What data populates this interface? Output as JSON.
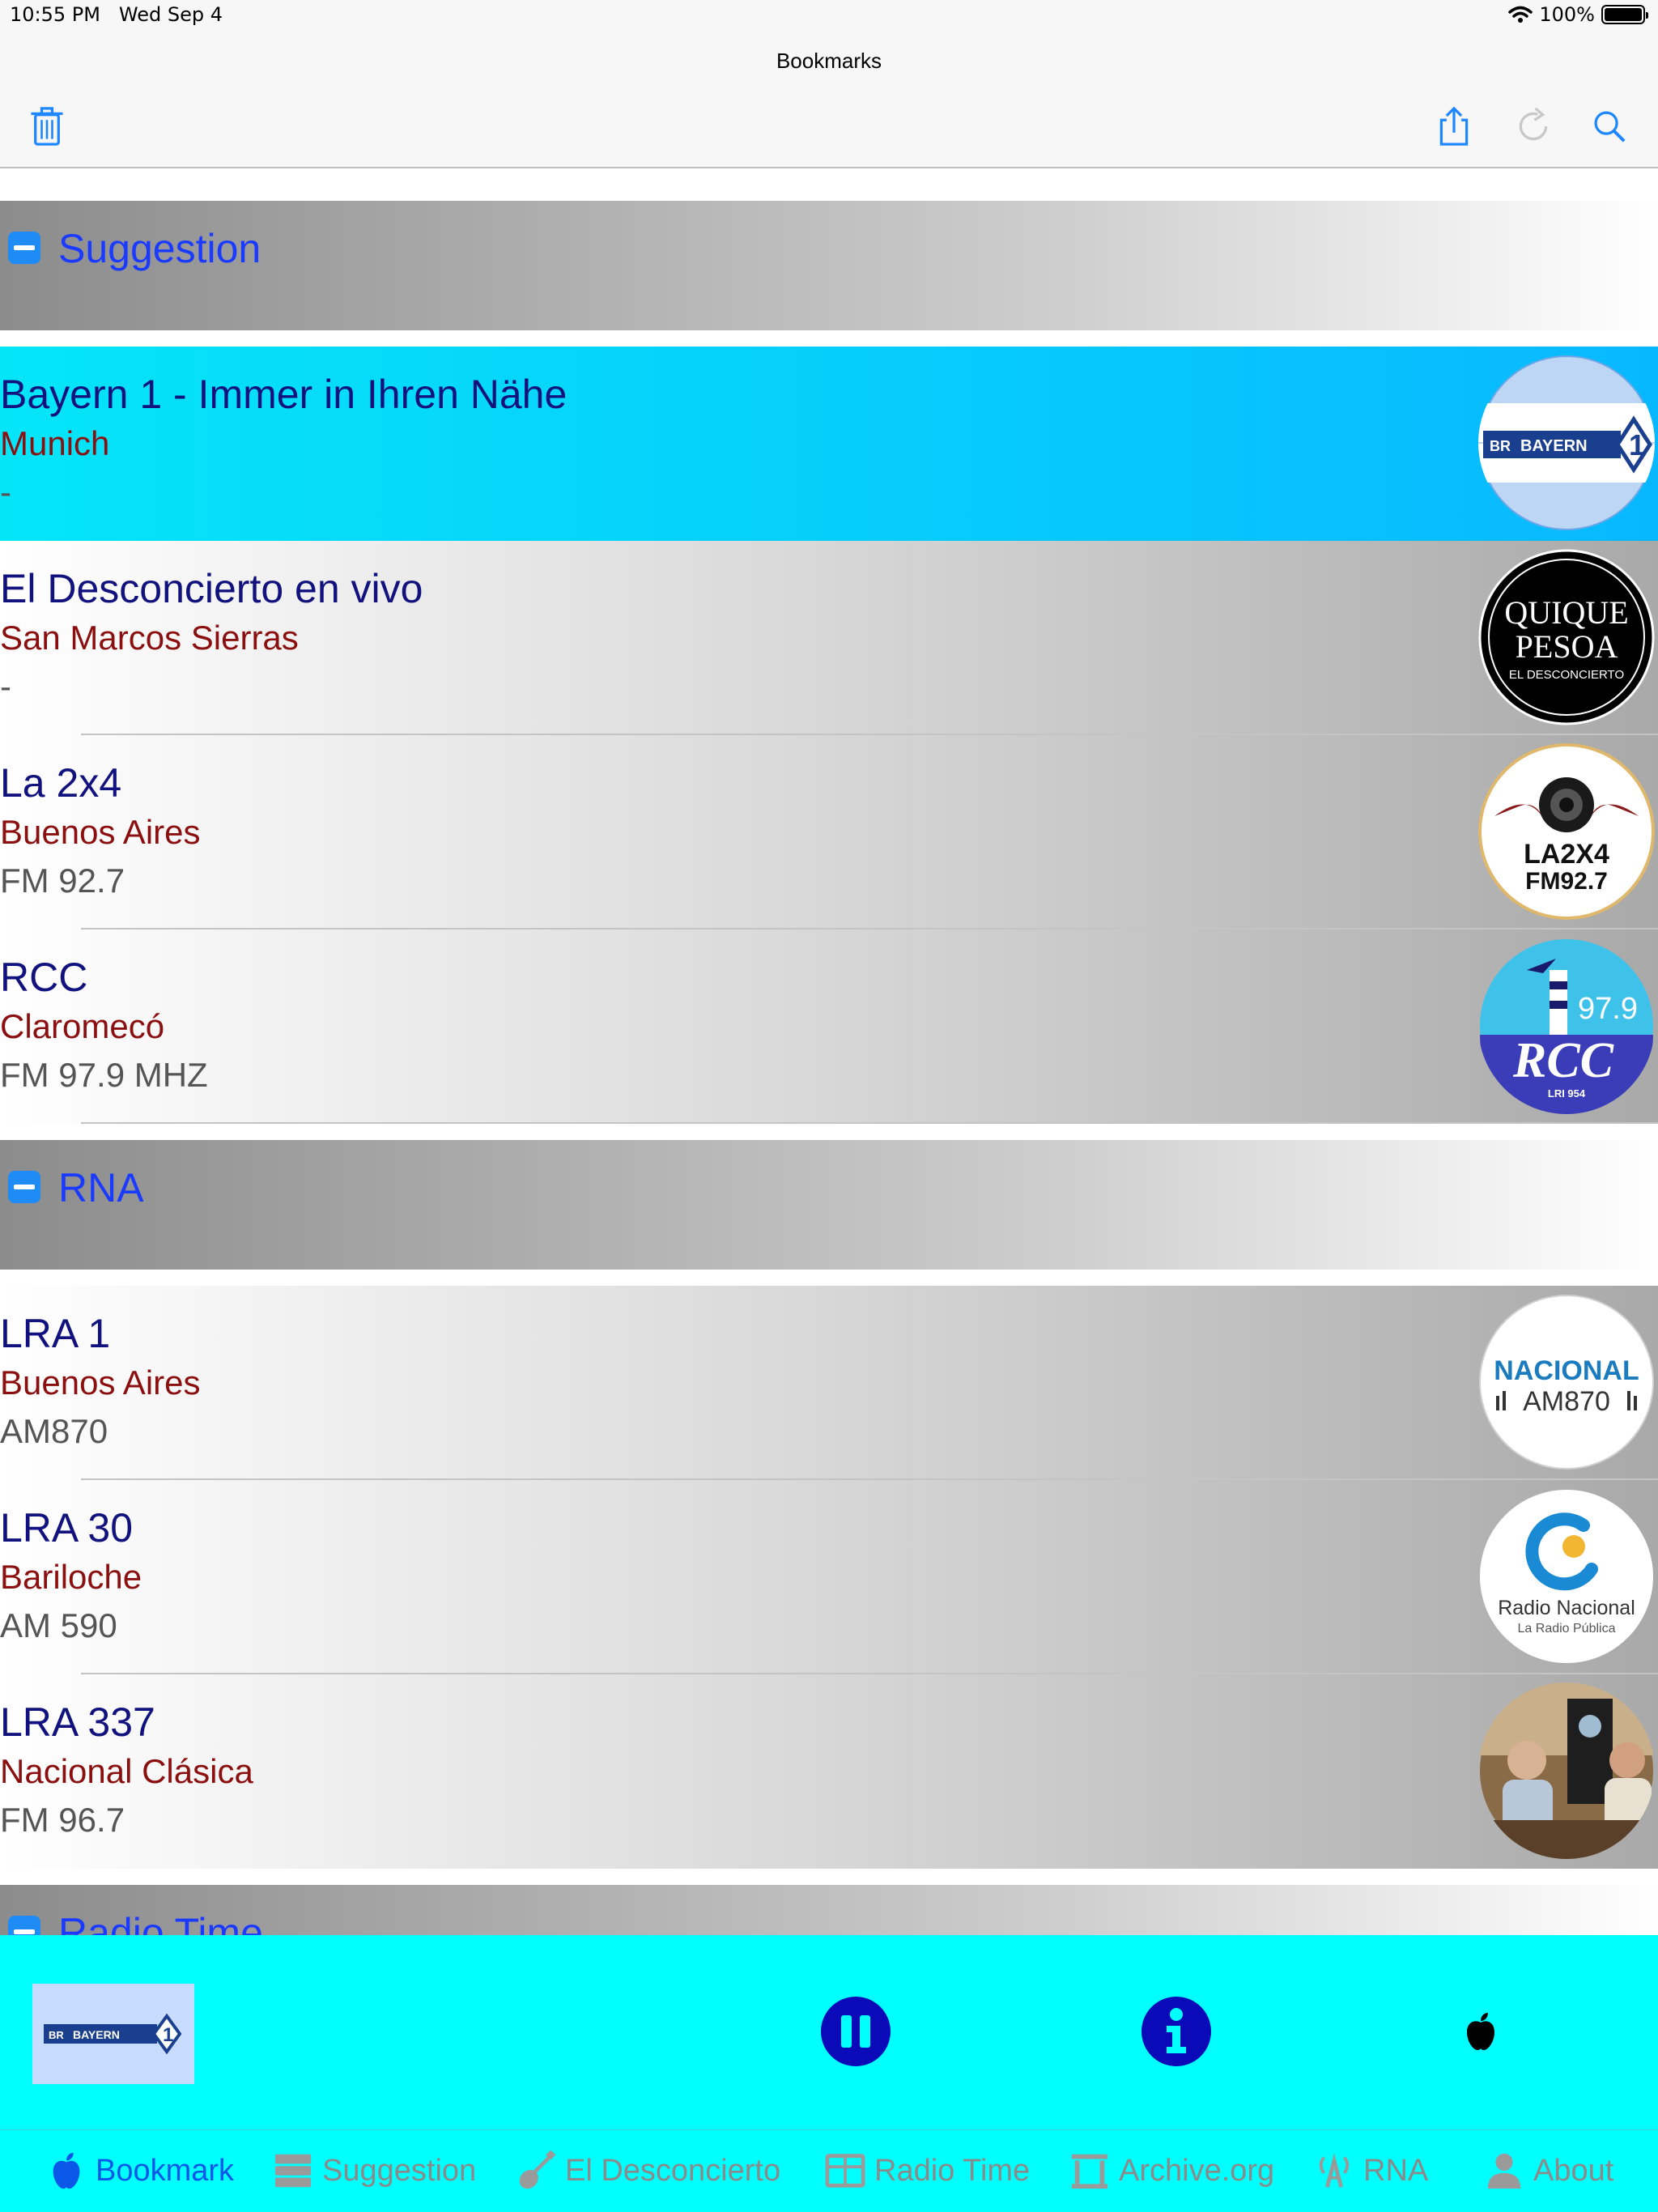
{
  "status_bar": {
    "time": "10:55 PM",
    "date": "Wed Sep 4",
    "battery": "100%"
  },
  "nav": {
    "title": "Bookmarks"
  },
  "sections": [
    {
      "title": "Suggestion",
      "stations": [
        {
          "name": "Bayern 1 - Immer in Ihren Nähe",
          "city": "Munich",
          "info": "-",
          "logo_text": "BAYERN",
          "selected": true
        },
        {
          "name": "El Desconcierto en vivo",
          "city": "San Marcos Sierras",
          "info": "-",
          "logo_text": "QUIQUE PESOA",
          "logo_sub": "EL DESCONCIERTO"
        },
        {
          "name": "La 2x4",
          "city": "Buenos Aires",
          "info": "FM 92.7",
          "logo_text": "LA2X4",
          "logo_sub": "FM92.7"
        },
        {
          "name": "RCC",
          "city": "Claromecó",
          "info": "FM 97.9 MHZ",
          "logo_text": "RCC",
          "logo_sub": "97.9",
          "logo_foot": "LRI 954"
        }
      ]
    },
    {
      "title": "RNA",
      "stations": [
        {
          "name": "LRA 1",
          "city": "Buenos Aires",
          "info": "AM870",
          "logo_text": "NACIONAL",
          "logo_sub": "AM870"
        },
        {
          "name": "LRA 30",
          "city": "Bariloche",
          "info": "AM 590",
          "logo_text": "Radio Nacional",
          "logo_sub": "La Radio Pública"
        },
        {
          "name": "LRA 337",
          "city": "Nacional Clásica",
          "info": "FM 96.7",
          "logo_text": ""
        }
      ]
    },
    {
      "title": "Radio Time"
    }
  ],
  "player": {
    "now_playing_logo": "BAYERN"
  },
  "tabs": [
    {
      "label": "Bookmark",
      "icon": "apple-icon",
      "active": true
    },
    {
      "label": "Suggestion",
      "icon": "server-icon"
    },
    {
      "label": "El Desconcierto",
      "icon": "guitar-icon"
    },
    {
      "label": "Radio Time",
      "icon": "grid-icon"
    },
    {
      "label": "Archive.org",
      "icon": "archive-icon"
    },
    {
      "label": "RNA",
      "icon": "antenna-icon"
    },
    {
      "label": "About",
      "icon": "person-icon"
    }
  ],
  "colors": {
    "accent": "#0b58e8",
    "section_title": "#1a3bff",
    "station_name": "#12127f",
    "station_city": "#8b0f0f",
    "player_bg": "#00ffff",
    "selected_row": "#08b8ff"
  }
}
